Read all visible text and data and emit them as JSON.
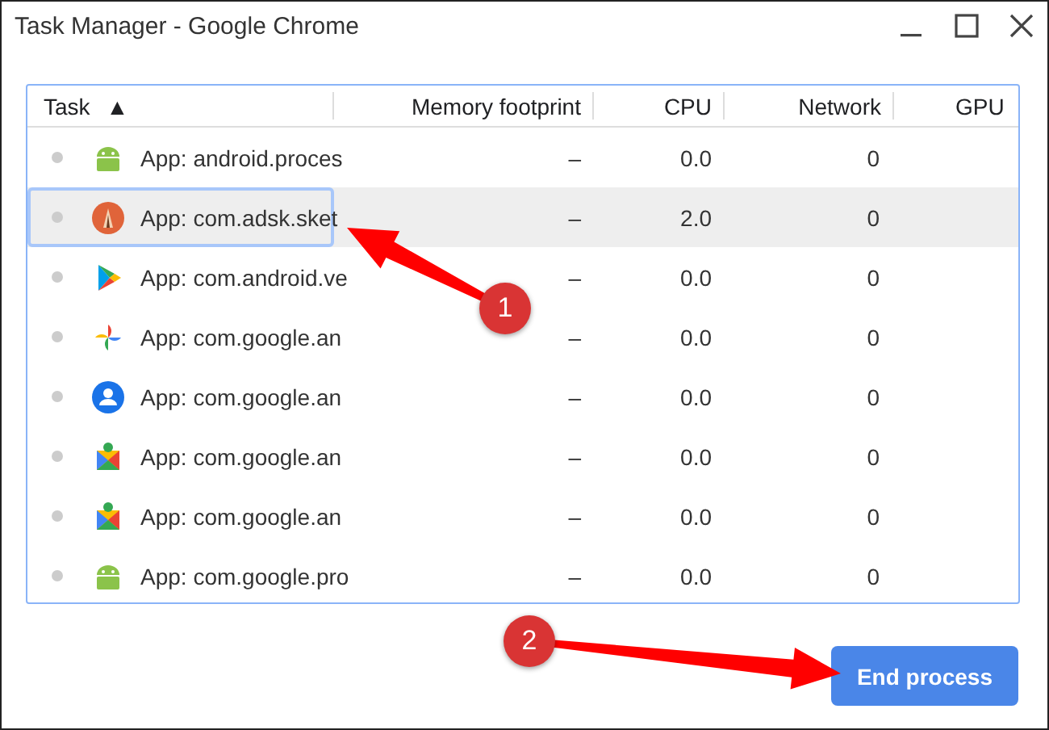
{
  "window": {
    "title": "Task Manager - Google Chrome"
  },
  "table": {
    "columns": [
      {
        "label": "Task",
        "sort": "▲"
      },
      {
        "label": "Memory footprint"
      },
      {
        "label": "CPU"
      },
      {
        "label": "Network"
      },
      {
        "label": "GPU"
      }
    ],
    "rows": [
      {
        "kind": "android",
        "task": "App: android.proces",
        "memory": "–",
        "cpu": "0.0",
        "network": "0",
        "selected": false
      },
      {
        "kind": "sketch",
        "task": "App: com.adsk.sket",
        "memory": "–",
        "cpu": "2.0",
        "network": "0",
        "selected": true
      },
      {
        "kind": "play",
        "task": "App: com.android.ve",
        "memory": "–",
        "cpu": "0.0",
        "network": "0",
        "selected": false
      },
      {
        "kind": "pinwheel",
        "task": "App: com.google.an",
        "memory": "–",
        "cpu": "0.0",
        "network": "0",
        "selected": false
      },
      {
        "kind": "contacts",
        "task": "App: com.google.an",
        "memory": "–",
        "cpu": "0.0",
        "network": "0",
        "selected": false
      },
      {
        "kind": "puzzle",
        "task": "App: com.google.an",
        "memory": "–",
        "cpu": "0.0",
        "network": "0",
        "selected": false
      },
      {
        "kind": "puzzle",
        "task": "App: com.google.an",
        "memory": "–",
        "cpu": "0.0",
        "network": "0",
        "selected": false
      },
      {
        "kind": "android",
        "task": "App: com.google.pro",
        "memory": "–",
        "cpu": "0.0",
        "network": "0",
        "selected": false
      }
    ]
  },
  "buttons": [
    {
      "label": "End process"
    }
  ],
  "annotations": [
    {
      "label": "1"
    },
    {
      "label": "2"
    }
  ]
}
